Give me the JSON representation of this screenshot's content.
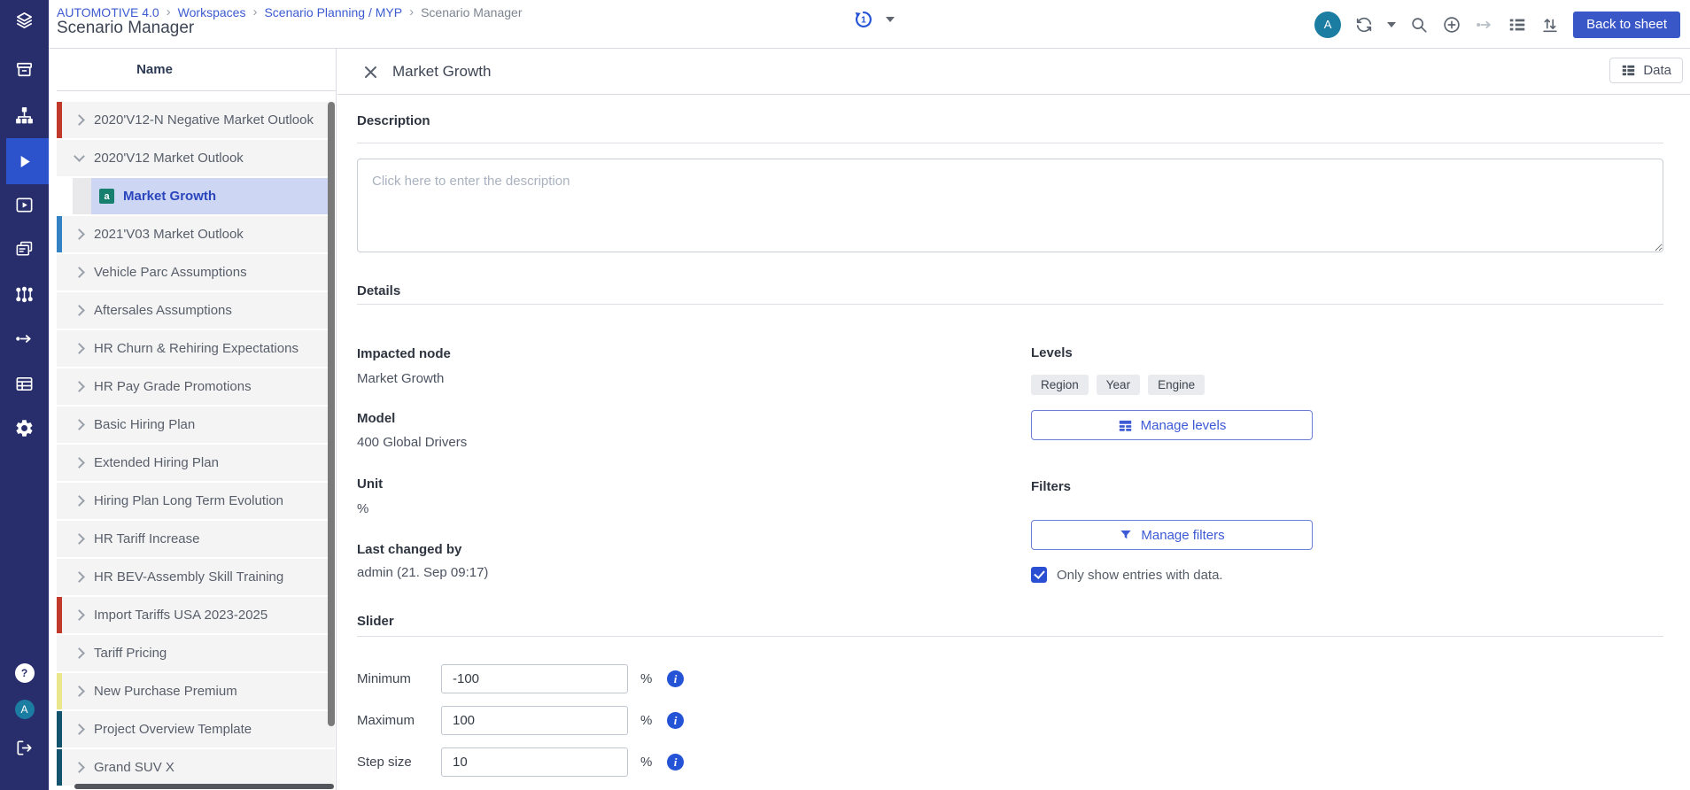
{
  "app": {
    "breadcrumb": [
      "AUTOMOTIVE 4.0",
      "Workspaces",
      "Scenario Planning / MYP",
      "Scenario Manager"
    ],
    "breadcrumb_separator": "›",
    "page_title": "Scenario Manager",
    "back_button": "Back to sheet",
    "history_count": "1",
    "avatar_initial": "A"
  },
  "rail": {
    "icons": [
      "layers-logo-icon",
      "archive-icon",
      "sitemap-icon",
      "play-icon",
      "video-play-icon",
      "slides-copy-icon",
      "network-icon",
      "flow-arrow-icon",
      "table-icon",
      "gear-icon",
      "help-icon",
      "user-avatar",
      "logout-icon"
    ],
    "active_item": "play-icon",
    "help_glyph": "?",
    "avatar_initial": "A"
  },
  "header_icons": [
    "user-avatar",
    "refresh-icon",
    "chevron-down-icon",
    "search-icon",
    "zoom-in-icon",
    "flow-arrow-icon",
    "list-icon",
    "sort-arrows-icon"
  ],
  "tree": {
    "header": "Name",
    "assumption_icon_glyph": "a",
    "items": [
      {
        "label": "2020'V12-N Negative Market Outlook",
        "bar": "#c0392b"
      },
      {
        "label": "2020'V12 Market Outlook",
        "expanded": true
      },
      {
        "label": "Market Growth",
        "child": true,
        "selected": true
      },
      {
        "label": "2021'V03 Market Outlook",
        "bar": "#3383c4"
      },
      {
        "label": "Vehicle Parc Assumptions"
      },
      {
        "label": "Aftersales Assumptions"
      },
      {
        "label": "HR Churn & Rehiring Expectations"
      },
      {
        "label": "HR Pay Grade Promotions"
      },
      {
        "label": "Basic Hiring Plan"
      },
      {
        "label": "Extended Hiring Plan"
      },
      {
        "label": "Hiring Plan Long Term Evolution"
      },
      {
        "label": "HR Tariff Increase"
      },
      {
        "label": "HR BEV-Assembly Skill Training"
      },
      {
        "label": "Import Tariffs USA 2023-2025",
        "bar": "#c0392b"
      },
      {
        "label": "Tariff Pricing"
      },
      {
        "label": "New Purchase Premium",
        "bar": "#e9e68c"
      },
      {
        "label": "Project Overview Template",
        "bar": "#14536e"
      },
      {
        "label": "Grand SUV X",
        "bar": "#14536e"
      }
    ]
  },
  "tab": {
    "title": "Market Growth",
    "data_button": "Data"
  },
  "description": {
    "heading": "Description",
    "placeholder": "Click here to enter the description"
  },
  "details": {
    "heading": "Details",
    "impacted_node_label": "Impacted node",
    "impacted_node": "Market Growth",
    "model_label": "Model",
    "model": "400 Global Drivers",
    "unit_label": "Unit",
    "unit": "%",
    "last_changed_label": "Last changed by",
    "last_changed": "admin (21. Sep 09:17)",
    "levels_label": "Levels",
    "levels": [
      "Region",
      "Year",
      "Engine"
    ],
    "manage_levels": "Manage levels",
    "filters_label": "Filters",
    "manage_filters": "Manage filters",
    "only_show_label": "Only show entries with data.",
    "only_show_checked": true
  },
  "slider": {
    "heading": "Slider",
    "info_glyph": "i",
    "rows": [
      {
        "label": "Minimum",
        "value": "-100",
        "unit": "%"
      },
      {
        "label": "Maximum",
        "value": "100",
        "unit": "%"
      },
      {
        "label": "Step size",
        "value": "10",
        "unit": "%"
      }
    ]
  },
  "colors": {
    "rail_bg": "#272e6b",
    "rail_active": "#2c52cc",
    "primary_button": "#3a57c8",
    "link_blue": "#3d5bd0",
    "selected_row_bg": "#cdd6f3",
    "selected_row_text": "#2b46bd",
    "assumption_icon_bg": "#177f6d",
    "avatar_bg": "#1c7da2",
    "accent_blue": "#2553d6",
    "checkbox_blue": "#2b4fd3",
    "chip_bg": "#e9ebee"
  }
}
